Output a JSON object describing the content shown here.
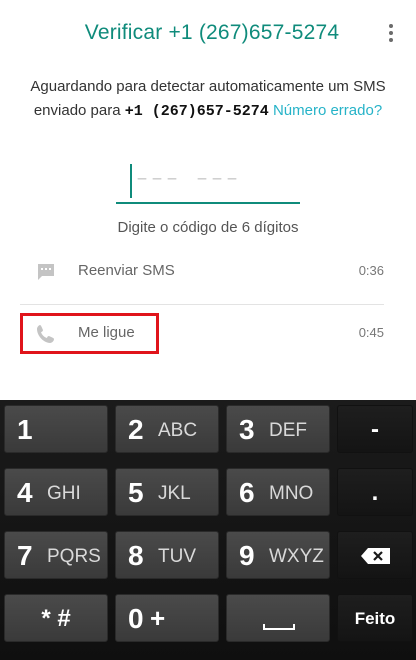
{
  "header": {
    "title": "Verificar +1 (267)657-5274",
    "menu_icon": "more-vert-icon"
  },
  "description": {
    "text": "Aguardando para detectar automaticamente um SMS enviado para",
    "phone": "+1 (267)657-5274",
    "link": "Número errado?"
  },
  "code_input": {
    "placeholder": "––– –––"
  },
  "hint": "Digite o código de 6 dígitos",
  "options": [
    {
      "label": "Reenviar SMS",
      "timer": "0:36",
      "icon": "message-icon"
    },
    {
      "label": "Me ligue",
      "timer": "0:45",
      "icon": "phone-icon"
    }
  ],
  "highlight_color": "#e0141b",
  "accent_color": "#0f8b7b",
  "keyboard": {
    "keys": [
      {
        "digit": "1",
        "letters": ""
      },
      {
        "digit": "2",
        "letters": "ABC"
      },
      {
        "digit": "3",
        "letters": "DEF"
      },
      {
        "digit": "4",
        "letters": "GHI"
      },
      {
        "digit": "5",
        "letters": "JKL"
      },
      {
        "digit": "6",
        "letters": "MNO"
      },
      {
        "digit": "7",
        "letters": "PQRS"
      },
      {
        "digit": "8",
        "letters": "TUV"
      },
      {
        "digit": "9",
        "letters": "WXYZ"
      },
      {
        "digit": "0",
        "letters": "+"
      }
    ],
    "minus": "-",
    "period": ".",
    "star_hash": "* #",
    "done": "Feito"
  }
}
